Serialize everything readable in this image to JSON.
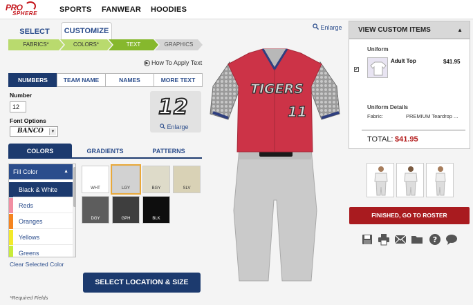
{
  "brand": {
    "line1": "PRO",
    "line2": "SPHERE"
  },
  "top_nav": [
    "SPORTS",
    "FANWEAR",
    "HOODIES"
  ],
  "main_tabs": {
    "select": "SELECT",
    "customize": "CUSTOMIZE"
  },
  "steps": [
    "FABRICS*",
    "COLORS*",
    "TEXT",
    "GRAPHICS"
  ],
  "how_to_apply": "How To Apply Text",
  "text_tabs": [
    "NUMBERS",
    "TEAM NAME",
    "NAMES",
    "MORE TEXT"
  ],
  "number": {
    "label": "Number",
    "value": "12"
  },
  "font_options": {
    "label": "Font Options",
    "value": "BANCO"
  },
  "preview": {
    "number": "12",
    "enlarge": "Enlarge"
  },
  "color_tabs": [
    "COLORS",
    "GRADIENTS",
    "PATTERNS"
  ],
  "fill": {
    "header": "Fill Color",
    "items": [
      {
        "label": "Black & White",
        "swatch": "#1c3a6e"
      },
      {
        "label": "Reds",
        "swatch": "#f28fa3"
      },
      {
        "label": "Oranges",
        "swatch": "#f5841f"
      },
      {
        "label": "Yellows",
        "swatch": "#f3ea2a"
      },
      {
        "label": "Greens",
        "swatch": "#c9ec3a"
      }
    ]
  },
  "clear_selected_color": "Clear Selected Color",
  "swatches": [
    {
      "code": "WHT",
      "color": "#ffffff",
      "text": "#333333"
    },
    {
      "code": "LGY",
      "color": "#d2d2d2",
      "text": "#333333",
      "selected": true
    },
    {
      "code": "BGY",
      "color": "#dedbc9",
      "text": "#333333"
    },
    {
      "code": "SLV",
      "color": "#d9d2b6",
      "text": "#333333"
    },
    {
      "code": "DGY",
      "color": "#5d5d5d",
      "text": "#ffffff"
    },
    {
      "code": "GPH",
      "color": "#3e3e3e",
      "text": "#ffffff"
    },
    {
      "code": "BLK",
      "color": "#0e0e0e",
      "text": "#ffffff"
    }
  ],
  "select_location_button": "SELECT LOCATION & SIZE",
  "required_fields": "*Required Fields",
  "enlarge": "Enlarge",
  "jersey": {
    "team_text": "TIGERS",
    "number": "11"
  },
  "custom_items": {
    "header": "VIEW CUSTOM ITEMS",
    "section": "Uniform",
    "item_name": "Adult Top",
    "item_price": "$41.95",
    "details_label": "Uniform Details",
    "fabric_label": "Fabric:",
    "fabric_value": "PREMIUM Teardrop ...",
    "total_label": "TOTAL:",
    "total_value": "$41.95"
  },
  "finish_button": "FINISHED, GO TO ROSTER",
  "tools": [
    "save-icon",
    "print-icon",
    "email-icon",
    "folder-icon",
    "help-icon",
    "chat-icon"
  ],
  "colors": {
    "navy": "#1c3a6e",
    "jersey_red": "#cc3347",
    "pants_gray": "#c9c9c9",
    "finish_red": "#a91b1f",
    "step_green": "#86b82d"
  }
}
